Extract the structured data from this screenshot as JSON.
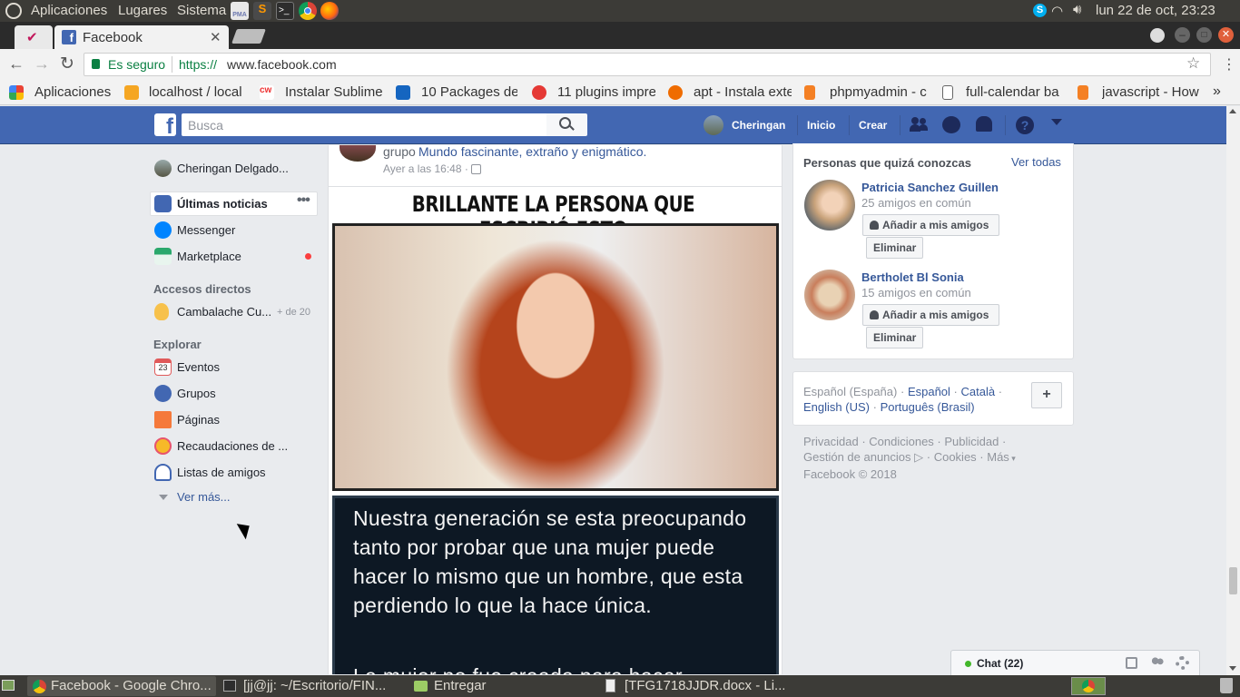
{
  "sysbar": {
    "menus": [
      "Aplicaciones",
      "Lugares",
      "Sistema"
    ],
    "clock": "lun 22 de oct, 23:23",
    "icons": [
      "ubuntu-logo-icon",
      "pma-icon",
      "sublime-icon",
      "terminal-icon",
      "chrome-icon",
      "firefox-icon",
      "skype-icon",
      "wifi-icon",
      "volume-icon"
    ]
  },
  "browser": {
    "tab_title": "Facebook",
    "secure_label": "Es seguro",
    "url_scheme": "https://",
    "url_host": "www.facebook.com",
    "bookmarks": [
      "Aplicaciones",
      "localhost / local",
      "Instalar Sublime",
      "10 Packages de",
      "11 plugins impre",
      "apt - Instala exte",
      "phpmyadmin - c",
      "full-calendar ba",
      "javascript - How"
    ]
  },
  "fbheader": {
    "search_placeholder": "Busca",
    "profile_name": "Cheringan",
    "home": "Inicio",
    "create": "Crear"
  },
  "leftnav": {
    "profile": "Cheringan Delgado...",
    "news": "Últimas noticias",
    "messenger": "Messenger",
    "marketplace": "Marketplace",
    "shortcuts_title": "Accesos directos",
    "shortcut1": "Cambalache Cu...",
    "shortcut1_badge": "+ de 20",
    "explore_title": "Explorar",
    "events": "Eventos",
    "events_day": "23",
    "groups": "Grupos",
    "pages": "Páginas",
    "fundraisers": "Recaudaciones de ...",
    "friendlists": "Listas de amigos",
    "see_more": "Ver más..."
  },
  "post": {
    "group_prefix": "grupo",
    "group_name": "Mundo fascinante, extraño y enigmático.",
    "timestamp": "Ayer a las 16:48 ·",
    "headline": "BRILLANTE LA PERSONA QUE ESCRIBIÓ ESTO",
    "body": "Nuestra generación se esta preocupando tanto por probar que una mujer puede hacer lo mismo que un hombre, que esta perdiendo lo que la hace única.",
    "body2": "La mujer no fue creada para hacer"
  },
  "pymk": {
    "title": "Personas que quizá conozcas",
    "see_all": "Ver todas",
    "people": [
      {
        "name": "Patricia Sanchez Guillen",
        "mutual": "25 amigos en común",
        "add": "Añadir a mis amigos",
        "remove": "Eliminar"
      },
      {
        "name": "Bertholet Bl Sonia",
        "mutual": "15 amigos en común",
        "add": "Añadir a mis amigos",
        "remove": "Eliminar"
      }
    ]
  },
  "languages": {
    "current": "Español (España)",
    "sep": "·",
    "es": "Español",
    "ca": "Català",
    "en": "English (US)",
    "pt": "Português (Brasil)",
    "plus": "+"
  },
  "footer": {
    "privacy": "Privacidad",
    "conditions": "Condiciones",
    "ads": "Publicidad",
    "adchoices": "Gestión de anuncios",
    "cookies": "Cookies",
    "more": "Más",
    "copyright": "Facebook © 2018"
  },
  "chat": {
    "label": "Chat (22)"
  },
  "taskbar": {
    "items": [
      "Facebook - Google Chro...",
      "[jj@jj: ~/Escritorio/FIN...",
      "Entregar",
      "[TFG1718JJDR.docx - Li..."
    ]
  },
  "colors": {
    "fb_blue": "#4267b2",
    "link": "#365899",
    "online_green": "#42b72a",
    "notif_red": "#fa3e3e"
  }
}
